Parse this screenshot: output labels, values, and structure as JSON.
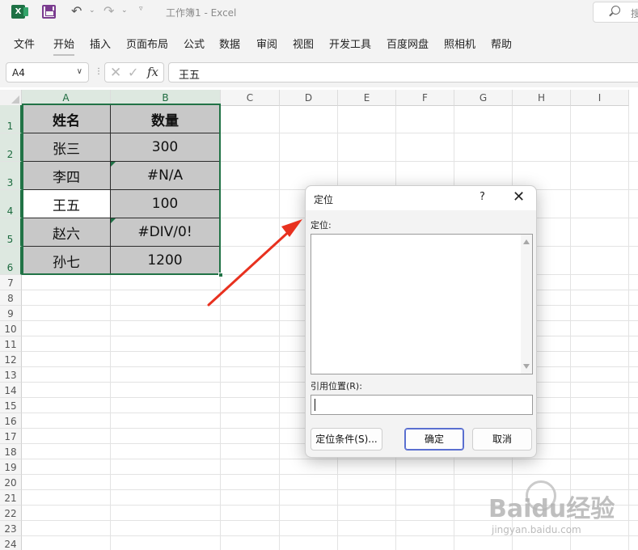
{
  "window": {
    "title": "工作簿1  -  Excel",
    "search_hint": "搜"
  },
  "ribbon": {
    "tabs": [
      "文件",
      "开始",
      "插入",
      "页面布局",
      "公式",
      "数据",
      "审阅",
      "视图",
      "开发工具",
      "百度网盘",
      "照相机",
      "帮助"
    ],
    "active_tab": "开始"
  },
  "formula_bar": {
    "name_box": "A4",
    "separator": "⋮",
    "cancel_icon": "✕",
    "enter_icon": "✓",
    "fx_label": "fx",
    "content": "王五"
  },
  "sheet": {
    "columns": [
      "A",
      "B",
      "C",
      "D",
      "E",
      "F",
      "G",
      "H",
      "I"
    ],
    "rows": [
      "1",
      "2",
      "3",
      "4",
      "5",
      "6",
      "7",
      "8",
      "9",
      "10",
      "11",
      "12",
      "13",
      "14",
      "15",
      "16",
      "17",
      "18",
      "19",
      "20",
      "21",
      "22",
      "23",
      "24"
    ],
    "selected_range": "A1:B6",
    "active_cell": "A4",
    "table": {
      "headers": [
        "姓名",
        "数量"
      ],
      "rows": [
        [
          "张三",
          "300"
        ],
        [
          "李四",
          "#N/A"
        ],
        [
          "王五",
          "100"
        ],
        [
          "赵六",
          "#DIV/0!"
        ],
        [
          "孙七",
          "1200"
        ]
      ]
    }
  },
  "dialog": {
    "title": "定位",
    "help": "?",
    "close": "✕",
    "list_label": "定位:",
    "reference_label": "引用位置(R):",
    "reference_value": "",
    "special_button": "定位条件(S)...",
    "ok_button": "确定",
    "cancel_button": "取消"
  },
  "watermark": {
    "brand": "Baidu经验",
    "url": "jingyan.baidu.com"
  },
  "colors": {
    "excel_green": "#217346",
    "arrow_red": "#e8311f",
    "cell_fill": "#c8c8c8"
  }
}
